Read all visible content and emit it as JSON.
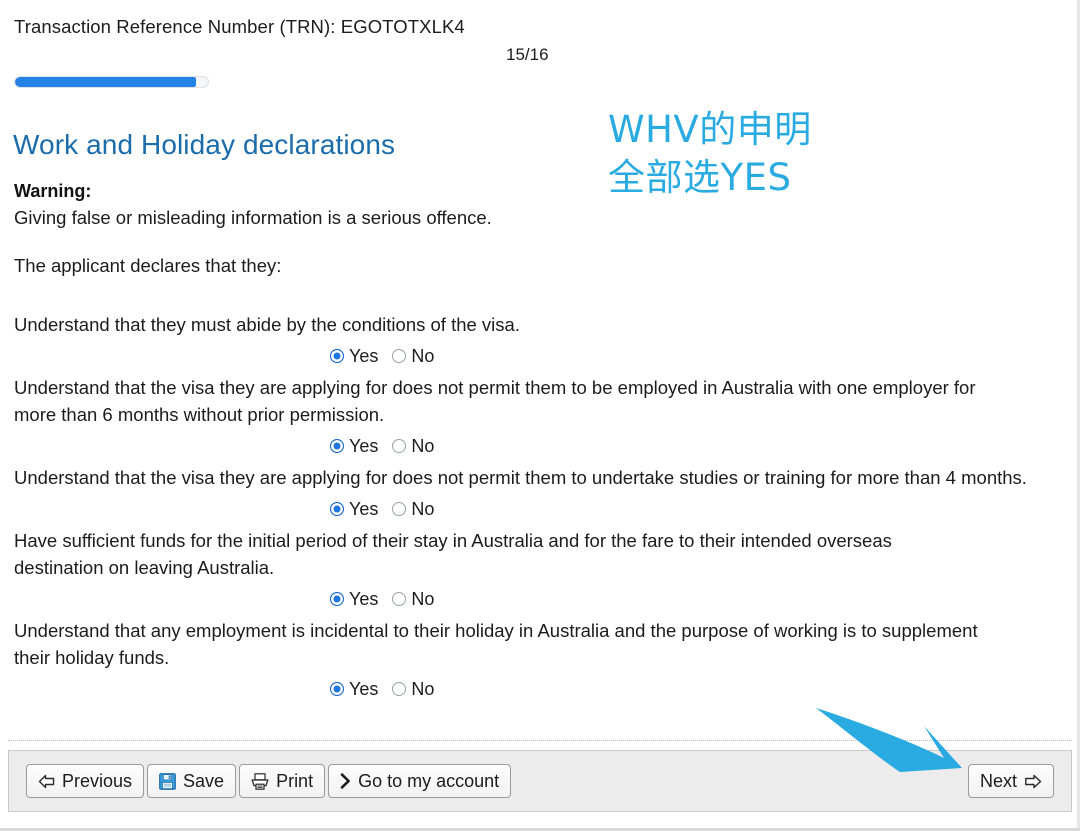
{
  "header": {
    "trn_line": "Transaction Reference Number (TRN): EGOTOTXLK4",
    "page_counter": "15/16",
    "progress_percent": 94
  },
  "section": {
    "heading": "Work and Holiday declarations",
    "warning_label": "Warning:",
    "warning_text": "Giving false or misleading information is a serious offence.",
    "lead_in": "The applicant declares that they:"
  },
  "annotation": {
    "line1": "WHV的申明",
    "line2": "全部选YES",
    "color": "#29abe2",
    "arrow_color": "#29abe2"
  },
  "radio_options": {
    "yes": "Yes",
    "no": "No"
  },
  "declarations": [
    {
      "text": "Understand that they must abide by the conditions of the visa.",
      "selected": "Yes",
      "width_class": "w1"
    },
    {
      "text": "Understand that the visa they are applying for does not permit them to be employed in Australia with one employer for more than 6 months without prior permission.",
      "selected": "Yes",
      "width_class": "w1"
    },
    {
      "text": "Understand that the visa they are applying for does not permit them to undertake studies or training for more than 4 months.",
      "selected": "Yes",
      "width_class": ""
    },
    {
      "text": "Have sufficient funds for the initial period of their stay in Australia and for the fare to their intended overseas destination on leaving Australia.",
      "selected": "Yes",
      "width_class": "w1"
    },
    {
      "text": "Understand that any employment is incidental to their holiday in Australia and the purpose of working is to supplement their holiday funds.",
      "selected": "Yes",
      "width_class": "w1"
    }
  ],
  "toolbar": {
    "previous_label": "Previous",
    "save_label": "Save",
    "print_label": "Print",
    "account_label": "Go to my account",
    "next_label": "Next"
  },
  "colors": {
    "heading_blue": "#1b6cab",
    "progress_blue": "#2482e6",
    "radio_blue": "#1e77e0",
    "toolbar_bg": "#ececec"
  }
}
